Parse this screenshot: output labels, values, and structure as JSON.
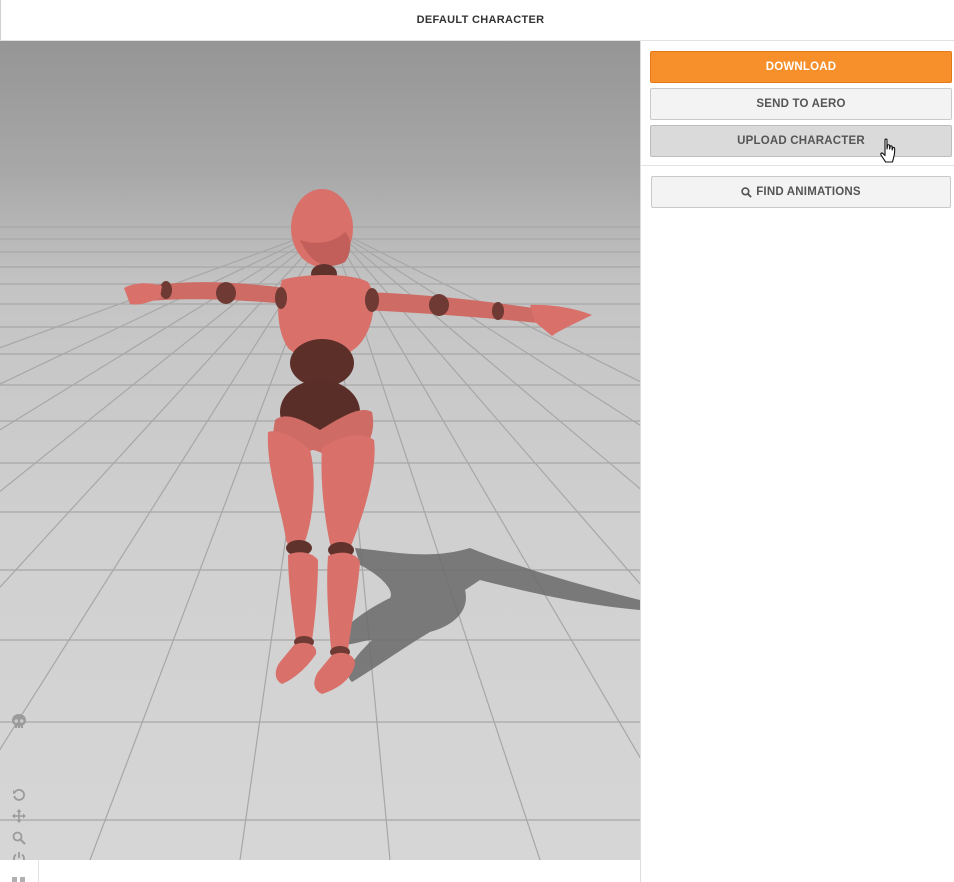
{
  "header": {
    "title": "DEFAULT CHARACTER"
  },
  "panel": {
    "download_label": "DOWNLOAD",
    "send_to_aero_label": "SEND TO AERO",
    "upload_label": "UPLOAD CHARACTER",
    "find_animations_label": "FIND ANIMATIONS"
  },
  "viewport_tools": [
    {
      "name": "skull-icon"
    },
    {
      "name": "reset-view-icon"
    },
    {
      "name": "move-icon"
    },
    {
      "name": "zoom-icon"
    },
    {
      "name": "power-icon"
    },
    {
      "name": "camera-icon"
    }
  ],
  "colors": {
    "accent": "#f78f2b",
    "character_skin": "#d9706a",
    "character_joint": "#6e3a33"
  }
}
